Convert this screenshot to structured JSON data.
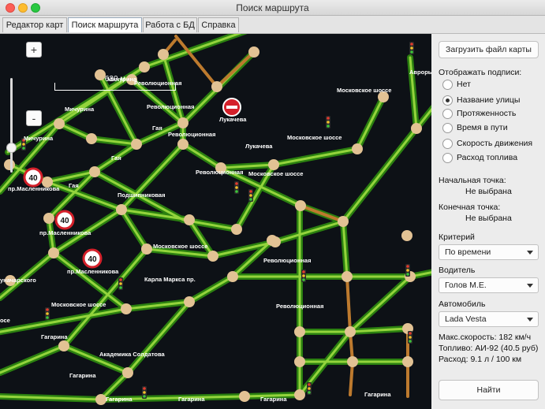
{
  "window": {
    "title": "Поиск маршрута"
  },
  "tabs": [
    {
      "label": "Редактор карт"
    },
    {
      "label": "Поиск маршрута"
    },
    {
      "label": "Работа с БД"
    },
    {
      "label": "Справка"
    }
  ],
  "map": {
    "zoom_in": "+",
    "zoom_out": "-",
    "scale_label": "630 м",
    "speed_limit": "40",
    "streets": [
      {
        "text": "Мичурина"
      },
      {
        "text": "Революционная"
      },
      {
        "text": "Мичурина"
      },
      {
        "text": "Революционная"
      },
      {
        "text": "Лукачева"
      },
      {
        "text": "Московское шоссе"
      },
      {
        "text": "Гая"
      },
      {
        "text": "Революционная"
      },
      {
        "text": "Мичурина"
      },
      {
        "text": "Лукачева"
      },
      {
        "text": "Московское шоссе"
      },
      {
        "text": "Гая"
      },
      {
        "text": "Революционная"
      },
      {
        "text": "Московское шоссе"
      },
      {
        "text": "пр.Масленникова"
      },
      {
        "text": "Гая"
      },
      {
        "text": "Подшипниковая"
      },
      {
        "text": "пр.Масленникова"
      },
      {
        "text": "Московское шоссе"
      },
      {
        "text": "Революционная"
      },
      {
        "text": "пр.Масленникова"
      },
      {
        "text": "Карла Маркса пр."
      },
      {
        "text": "уначарского"
      },
      {
        "text": "Московское шоссе"
      },
      {
        "text": "Революционная"
      },
      {
        "text": "осе"
      },
      {
        "text": "Гагарина"
      },
      {
        "text": "Академика Солдатова"
      },
      {
        "text": "Гагарина"
      },
      {
        "text": "Гагарина"
      },
      {
        "text": "Гагарина"
      },
      {
        "text": "Гагарина"
      },
      {
        "text": "Гагарина"
      },
      {
        "text": "Аврорь"
      }
    ]
  },
  "sidebar": {
    "load_button": "Загрузить файл карты",
    "labels_heading": "Отображать подписи:",
    "label_options": [
      {
        "label": "Нет",
        "selected": false
      },
      {
        "label": "Название улицы",
        "selected": true
      },
      {
        "label": "Протяженность",
        "selected": false
      },
      {
        "label": "Время в пути",
        "selected": false
      },
      {
        "label": "Скорость движения",
        "selected": false
      },
      {
        "label": "Расход топлива",
        "selected": false
      }
    ],
    "start_heading": "Начальная точка:",
    "start_value": "Не выбрана",
    "end_heading": "Конечная точка:",
    "end_value": "Не выбрана",
    "criterion_heading": "Критерий",
    "criterion_value": "По времени",
    "driver_heading": "Водитель",
    "driver_value": "Голов М.Е.",
    "car_heading": "Автомобиль",
    "car_value": "Lada Vesta",
    "max_speed": "Макс.скорость: 182 км/ч",
    "fuel": "Топливо: АИ-92 (40.5 руб)",
    "consumption": "Расход: 9.1 л / 100 км",
    "find_button": "Найти"
  },
  "colors": {
    "map_bg": "#0d1116",
    "road_glow": "#3a9a12",
    "road_core": "#8fd13a",
    "road_orange": "#c07a30",
    "node": "#e2c294"
  }
}
